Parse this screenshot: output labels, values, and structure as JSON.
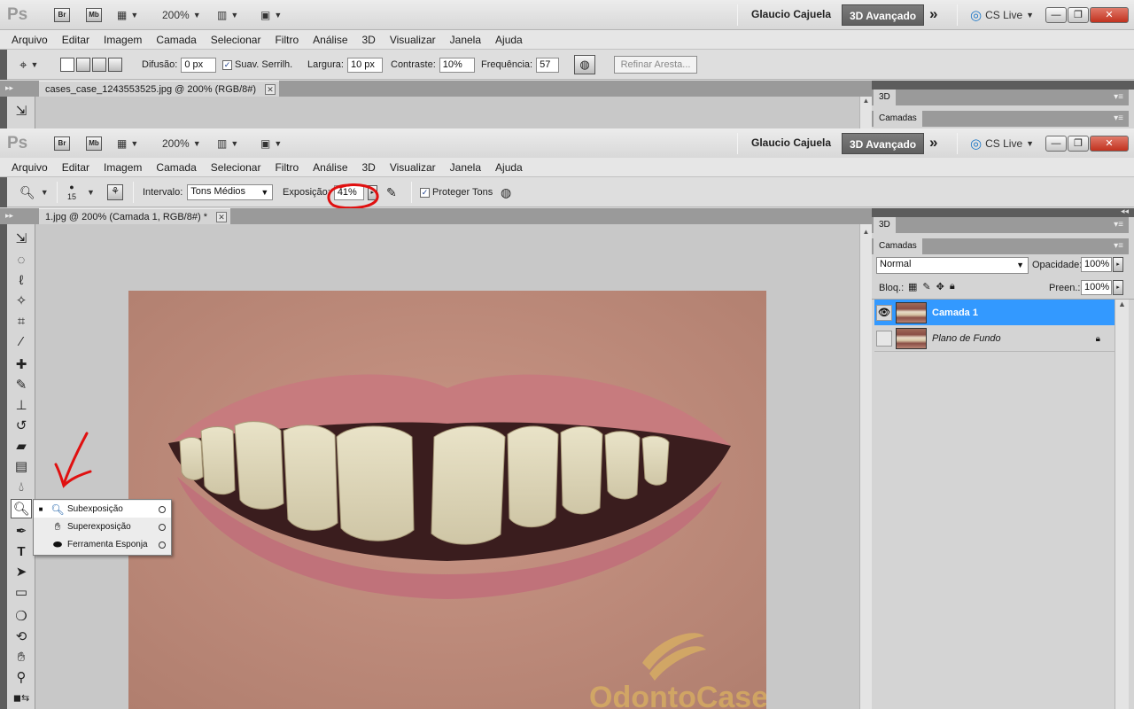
{
  "app": {
    "logo": "Ps",
    "bridge_label": "Br",
    "minibridge_label": "Mb",
    "zoom": "200%"
  },
  "user": {
    "name": "Glaucio Cajuela"
  },
  "workspace": {
    "active": "3D Avançado",
    "more": "»"
  },
  "cslive": {
    "label": "CS Live"
  },
  "window_buttons": {
    "minimize": "—",
    "restore": "❐",
    "close": "✕"
  },
  "menu": [
    "Arquivo",
    "Editar",
    "Imagem",
    "Camada",
    "Selecionar",
    "Filtro",
    "Análise",
    "3D",
    "Visualizar",
    "Janela",
    "Ajuda"
  ],
  "back_options": {
    "difusao_label": "Difusão:",
    "difusao_value": "0 px",
    "suav_label": "Suav. Serrilh.",
    "largura_label": "Largura:",
    "largura_value": "10 px",
    "contraste_label": "Contraste:",
    "contraste_value": "10%",
    "frequencia_label": "Frequência:",
    "frequencia_value": "57",
    "refinar_label": "Refinar Aresta..."
  },
  "back_document": {
    "tab_title": "cases_case_1243553525.jpg @ 200% (RGB/8#)"
  },
  "options": {
    "brush_size": "15",
    "intervalo_label": "Intervalo:",
    "intervalo_value": "Tons Médios",
    "exposicao_label": "Exposição:",
    "exposicao_value": "41%",
    "proteger_label": "Proteger Tons"
  },
  "document": {
    "tab_title": "1.jpg @ 200% (Camada 1, RGB/8#) *",
    "close": "✕"
  },
  "panels": {
    "3d_tab": "3D",
    "layers_tab": "Camadas",
    "blend_mode": "Normal",
    "opacity_label": "Opacidade:",
    "opacity_value": "100%",
    "lock_label": "Bloq.:",
    "fill_label": "Preen.:",
    "fill_value": "100%",
    "layers": [
      {
        "name": "Camada 1",
        "selected": true,
        "visible": true
      },
      {
        "name": "Plano de Fundo",
        "selected": false,
        "visible": false,
        "locked": true
      }
    ]
  },
  "flyout": {
    "items": [
      {
        "label": "Subexposição",
        "icon": "dodge-icon",
        "selected": true
      },
      {
        "label": "Superexposição",
        "icon": "burn-icon",
        "selected": false
      },
      {
        "label": "Ferramenta Esponja",
        "icon": "sponge-icon",
        "selected": false
      }
    ]
  },
  "watermark": {
    "text": "OdontoCases"
  },
  "colors": {
    "accent_selected": "#3399ff",
    "annotation_red": "#e01010",
    "close_button": "#c2321f"
  }
}
